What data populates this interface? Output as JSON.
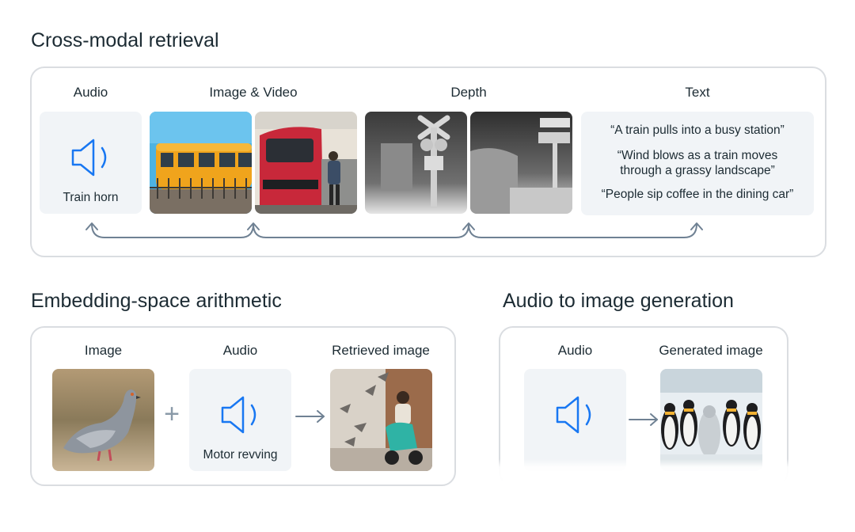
{
  "sections": {
    "cross_modal": {
      "title": "Cross-modal retrieval",
      "labels": {
        "audio": "Audio",
        "image_video": "Image & Video",
        "depth": "Depth",
        "text": "Text"
      },
      "audio_caption": "Train horn",
      "text_captions": [
        "“A train pulls into a busy station”",
        "“Wind blows as a train moves",
        "through a grassy landscape”",
        "“People sip coffee in the dining car”"
      ]
    },
    "embedding": {
      "title": "Embedding-space arithmetic",
      "labels": {
        "image": "Image",
        "audio": "Audio",
        "retrieved": "Retrieved image"
      },
      "audio_caption": "Motor revving",
      "plus": "+"
    },
    "generation": {
      "title": "Audio to image generation",
      "labels": {
        "audio": "Audio",
        "generated": "Generated image"
      }
    }
  },
  "colors": {
    "accent": "#1877f2",
    "arrow": "#6f8193",
    "panel_border": "#dadde1",
    "tile_bg": "#f1f4f7"
  },
  "icons": [
    "speaker-icon",
    "arrow-right-icon",
    "curved-arrow-icon"
  ]
}
